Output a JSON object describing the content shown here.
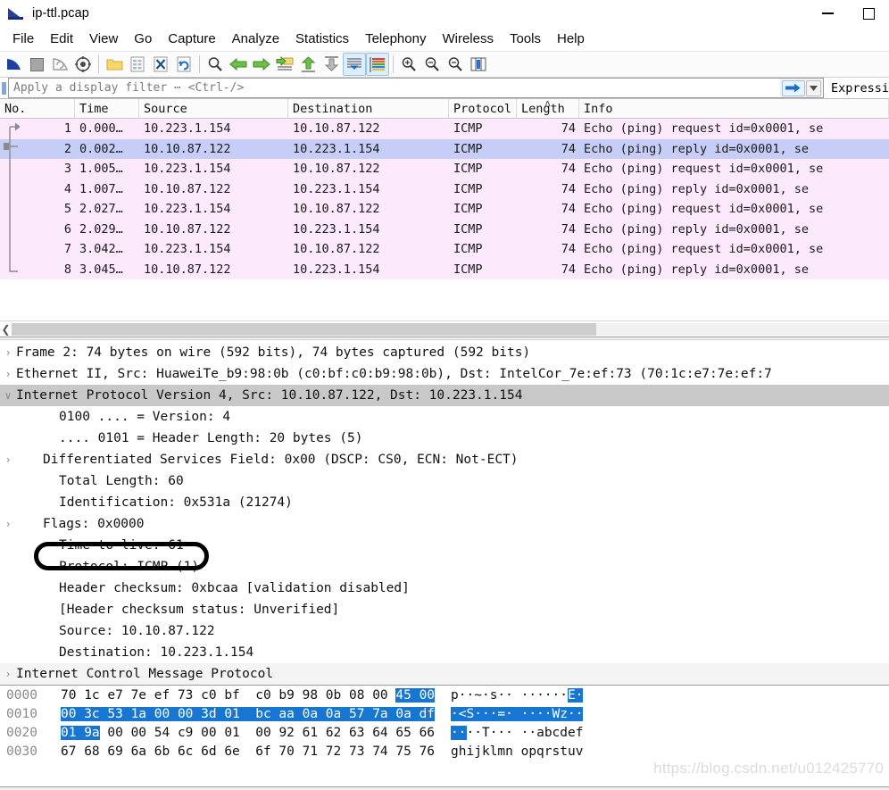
{
  "window": {
    "title": "ip-ttl.pcap",
    "logo_icon": "wireshark-shark-fin-icon",
    "minimize_icon": "minimize-icon",
    "maximize_icon": "maximize-icon"
  },
  "menubar": {
    "items": [
      {
        "label": "File"
      },
      {
        "label": "Edit"
      },
      {
        "label": "View"
      },
      {
        "label": "Go"
      },
      {
        "label": "Capture"
      },
      {
        "label": "Analyze"
      },
      {
        "label": "Statistics"
      },
      {
        "label": "Telephony"
      },
      {
        "label": "Wireless"
      },
      {
        "label": "Tools"
      },
      {
        "label": "Help"
      }
    ]
  },
  "toolbar": {
    "buttons": [
      {
        "name": "start-capture-icon",
        "selected": false
      },
      {
        "name": "stop-capture-icon",
        "selected": false
      },
      {
        "name": "restart-capture-icon",
        "selected": false
      },
      {
        "name": "capture-options-icon",
        "selected": false
      },
      {
        "name": "open-file-icon",
        "selected": false
      },
      {
        "name": "save-file-icon",
        "selected": false
      },
      {
        "name": "close-file-icon",
        "selected": false
      },
      {
        "name": "reload-file-icon",
        "selected": false
      },
      {
        "name": "find-packet-icon",
        "selected": false
      },
      {
        "name": "go-back-icon",
        "selected": false
      },
      {
        "name": "go-forward-icon",
        "selected": false
      },
      {
        "name": "go-to-packet-icon",
        "selected": false
      },
      {
        "name": "go-to-first-packet-icon",
        "selected": false
      },
      {
        "name": "go-to-last-packet-icon",
        "selected": false
      },
      {
        "name": "auto-scroll-icon",
        "selected": true
      },
      {
        "name": "colorize-packets-icon",
        "selected": true
      },
      {
        "name": "zoom-in-icon",
        "selected": false
      },
      {
        "name": "zoom-out-icon",
        "selected": false
      },
      {
        "name": "normal-size-icon",
        "selected": false
      },
      {
        "name": "resize-columns-icon",
        "selected": false
      }
    ]
  },
  "filter": {
    "placeholder": "Apply a display filter ⋯ <Ctrl-/>",
    "value": "",
    "apply_icon": "arrow-right-icon",
    "bookmark_icon": "filter-bookmark-icon",
    "dropdown_icon": "chevron-down-icon",
    "expression_label": "Expressi"
  },
  "packet_list": {
    "columns": [
      {
        "key": "no",
        "label": "No.",
        "sorted": false
      },
      {
        "key": "time",
        "label": "Time",
        "sorted": false
      },
      {
        "key": "source",
        "label": "Source",
        "sorted": false
      },
      {
        "key": "destination",
        "label": "Destination",
        "sorted": false
      },
      {
        "key": "protocol",
        "label": "Protocol",
        "sorted": false
      },
      {
        "key": "length",
        "label": "Length",
        "sorted": true,
        "sort_indicator": "ʌ"
      },
      {
        "key": "info",
        "label": "Info",
        "sorted": false
      }
    ],
    "row_color_normal": "#fce9fc",
    "row_color_selected": "#c6cdf7",
    "rows": [
      {
        "no": "1",
        "time": "0.000…",
        "source": "10.223.1.154",
        "destination": "10.10.87.122",
        "protocol": "ICMP",
        "length": "74",
        "info": "Echo (ping) request  id=0x0001, se",
        "selected": false
      },
      {
        "no": "2",
        "time": "0.002…",
        "source": "10.10.87.122",
        "destination": "10.223.1.154",
        "protocol": "ICMP",
        "length": "74",
        "info": "Echo (ping) reply    id=0x0001, se",
        "selected": true
      },
      {
        "no": "3",
        "time": "1.005…",
        "source": "10.223.1.154",
        "destination": "10.10.87.122",
        "protocol": "ICMP",
        "length": "74",
        "info": "Echo (ping) request  id=0x0001, se",
        "selected": false
      },
      {
        "no": "4",
        "time": "1.007…",
        "source": "10.10.87.122",
        "destination": "10.223.1.154",
        "protocol": "ICMP",
        "length": "74",
        "info": "Echo (ping) reply    id=0x0001, se",
        "selected": false
      },
      {
        "no": "5",
        "time": "2.027…",
        "source": "10.223.1.154",
        "destination": "10.10.87.122",
        "protocol": "ICMP",
        "length": "74",
        "info": "Echo (ping) request  id=0x0001, se",
        "selected": false
      },
      {
        "no": "6",
        "time": "2.029…",
        "source": "10.10.87.122",
        "destination": "10.223.1.154",
        "protocol": "ICMP",
        "length": "74",
        "info": "Echo (ping) reply    id=0x0001, se",
        "selected": false
      },
      {
        "no": "7",
        "time": "3.042…",
        "source": "10.223.1.154",
        "destination": "10.10.87.122",
        "protocol": "ICMP",
        "length": "74",
        "info": "Echo (ping) request  id=0x0001, se",
        "selected": false
      },
      {
        "no": "8",
        "time": "3.045…",
        "source": "10.10.87.122",
        "destination": "10.223.1.154",
        "protocol": "ICMP",
        "length": "74",
        "info": "Echo (ping) reply    id=0x0001, se",
        "selected": false
      }
    ]
  },
  "scrollbar": {
    "left_arrow_icon": "chevron-left-icon"
  },
  "detail_tree": {
    "rows": [
      {
        "twisty": "›",
        "indent": 0,
        "text": "Frame 2: 74 bytes on wire (592 bits), 74 bytes captured (592 bits)",
        "selected": false,
        "shaded": false
      },
      {
        "twisty": "›",
        "indent": 0,
        "text": "Ethernet II, Src: HuaweiTe_b9:98:0b (c0:bf:c0:b9:98:0b), Dst: IntelCor_7e:ef:73 (70:1c:e7:7e:ef:7",
        "selected": false,
        "shaded": false
      },
      {
        "twisty": "∨",
        "indent": 0,
        "text": "Internet Protocol Version 4, Src: 10.10.87.122, Dst: 10.223.1.154",
        "selected": true,
        "shaded": false
      },
      {
        "twisty": "",
        "indent": 2,
        "text": "0100 .... = Version: 4",
        "selected": false,
        "shaded": false
      },
      {
        "twisty": "",
        "indent": 2,
        "text": ".... 0101 = Header Length: 20 bytes (5)",
        "selected": false,
        "shaded": false
      },
      {
        "twisty": "›",
        "indent": 1,
        "text": "Differentiated Services Field: 0x00 (DSCP: CS0, ECN: Not-ECT)",
        "selected": false,
        "shaded": false
      },
      {
        "twisty": "",
        "indent": 2,
        "text": "Total Length: 60",
        "selected": false,
        "shaded": false
      },
      {
        "twisty": "",
        "indent": 2,
        "text": "Identification: 0x531a (21274)",
        "selected": false,
        "shaded": false
      },
      {
        "twisty": "›",
        "indent": 1,
        "text": "Flags: 0x0000",
        "selected": false,
        "shaded": false
      },
      {
        "twisty": "",
        "indent": 2,
        "text": "Time to live: 61",
        "selected": false,
        "shaded": false
      },
      {
        "twisty": "",
        "indent": 2,
        "text": "Protocol: ICMP (1)",
        "selected": false,
        "shaded": false
      },
      {
        "twisty": "",
        "indent": 2,
        "text": "Header checksum: 0xbcaa [validation disabled]",
        "selected": false,
        "shaded": false
      },
      {
        "twisty": "",
        "indent": 2,
        "text": "[Header checksum status: Unverified]",
        "selected": false,
        "shaded": false
      },
      {
        "twisty": "",
        "indent": 2,
        "text": "Source: 10.10.87.122",
        "selected": false,
        "shaded": false
      },
      {
        "twisty": "",
        "indent": 2,
        "text": "Destination: 10.223.1.154",
        "selected": false,
        "shaded": false
      },
      {
        "twisty": "›",
        "indent": 0,
        "text": "Internet Control Message Protocol",
        "selected": false,
        "shaded": true
      }
    ]
  },
  "annotation": {
    "shape": "black-oval-highlight",
    "target_text": "Time to live: 61"
  },
  "hex_pane": {
    "rows": [
      {
        "offset": "0000",
        "bytes_plain_1": "70 1c e7 7e ef 73 c0 bf  c0 b9 98 0b 08 00 ",
        "bytes_hl": "45 00",
        "ascii_plain_1": "p··~·s·· ······",
        "ascii_hl": "E·"
      },
      {
        "offset": "0010",
        "bytes_hl": "00 3c 53 1a 00 00 3d 01  bc aa 0a 0a 57 7a 0a df",
        "ascii_hl": "·<S···=· ····Wz··"
      },
      {
        "offset": "0020",
        "bytes_hl": "01 9a",
        "bytes_plain_2": " 00 00 54 c9 00 01  00 92 61 62 63 64 65 66",
        "ascii_hl": "··",
        "ascii_plain_2": "··T··· ··abcdef"
      },
      {
        "offset": "0030",
        "bytes_plain_1": "67 68 69 6a 6b 6c 6d 6e  6f 70 71 72 73 74 75 76",
        "ascii_plain_1": "ghijklmn opqrstuv"
      }
    ]
  },
  "watermark": {
    "text": "https://blog.csdn.net/u012425770"
  }
}
